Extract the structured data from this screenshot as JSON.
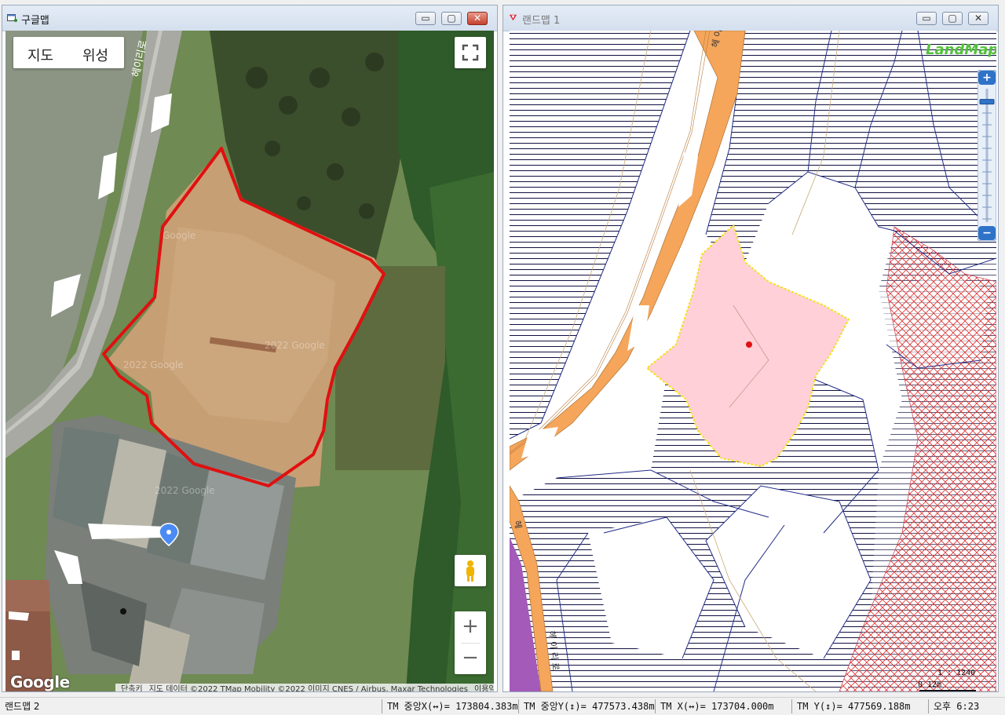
{
  "left_window": {
    "title": "구글맵",
    "buttons": {
      "minimize": "▭",
      "maximize": "▢",
      "close": "✕"
    },
    "map_type": {
      "map_label": "지도",
      "satellite_label": "위성"
    },
    "road_label": "헤이리로",
    "watermarks": [
      "Google",
      "2022 Google",
      "2022 Google",
      "2022 Google"
    ],
    "zoom_in": "+",
    "zoom_out": "−",
    "logo": "Google",
    "attribution": {
      "shortcuts": "단축키",
      "map_data": "지도 데이터 ©2022 TMap Mobility ©2022 이미지 CNES / Airbus, Maxar Technologies",
      "terms": "이용약관"
    }
  },
  "right_window": {
    "title": "랜드맵 1",
    "buttons": {
      "minimize": "▭",
      "maximize": "▢",
      "close": "✕"
    },
    "logo": "LandMap",
    "road_labels": [
      "헤 이",
      "헤",
      "헤 이 리 로"
    ],
    "zoom": {
      "plus": "+",
      "minus": "−",
      "level_fraction": 0.1
    },
    "scale": {
      "ratio": "1 : 1240",
      "zero": "0",
      "unit": "12m"
    }
  },
  "status_bar": {
    "window_name": "랜드맵 2",
    "tm_center_x": "TM 중앙X(↔)= 173804.383m",
    "tm_center_y": "TM 중앙Y(↕)= 477573.438m",
    "tm_x": "TM X(↔)= 173704.000m",
    "tm_y": "TM Y(↕)= 477569.188m",
    "clock": "오후 6:23"
  },
  "colors": {
    "parcel_outline": "#e01010",
    "road": "#f5a65b",
    "selected_parcel": "#ffd0d8",
    "selected_outline": "#f2e21a",
    "hatch_red": "#e03030",
    "purple_zone": "#a35ab8",
    "landmap_green": "#52c13a"
  }
}
